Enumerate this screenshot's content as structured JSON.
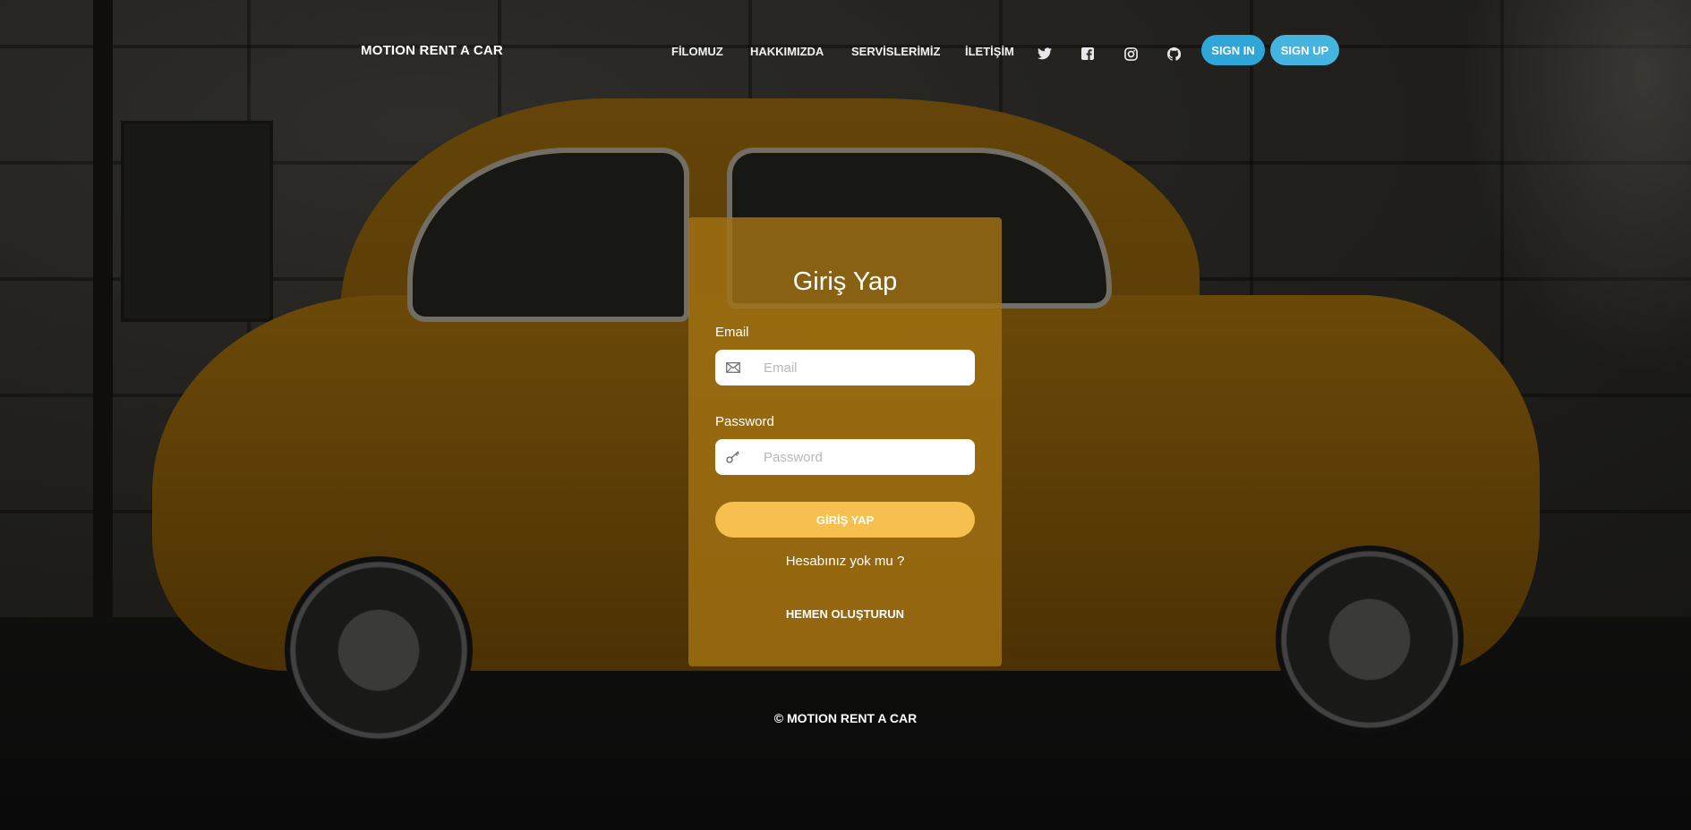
{
  "header": {
    "brand": "MOTION RENT A CAR",
    "nav": {
      "filomuz": "FİLOMUZ",
      "hakkimizda": "HAKKIMIZDA",
      "servislerimiz": "SERVİSLERİMİZ",
      "iletisim": "İLETİŞİM"
    },
    "social_icons": [
      "twitter-icon",
      "facebook-icon",
      "instagram-icon",
      "github-icon"
    ],
    "sign_in": "SIGN IN",
    "sign_up": "SIGN UP"
  },
  "login": {
    "title": "Giriş Yap",
    "email_label": "Email",
    "email_placeholder": "Email",
    "email_value": "",
    "password_label": "Password",
    "password_placeholder": "Password",
    "password_value": "",
    "submit": "GİRİŞ YAP",
    "no_account": "Hesabınız yok mu ?",
    "create_link": "HEMEN OLUŞTURUN"
  },
  "footer": {
    "copyright": "© MOTION RENT A CAR"
  },
  "colors": {
    "accent_blue": "#2ea7d8",
    "card_overlay": "#a27212",
    "submit_button": "#f6bf4f"
  }
}
